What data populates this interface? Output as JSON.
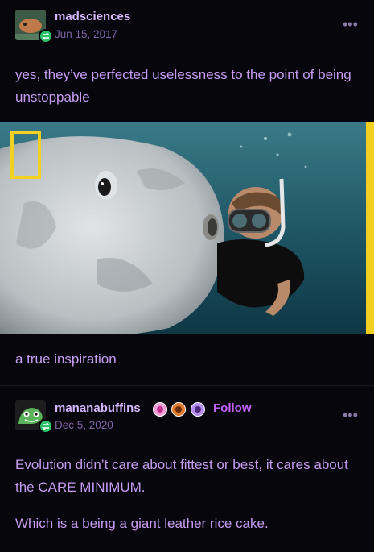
{
  "post1": {
    "username": "madsciences",
    "date": "Jun 15, 2017",
    "more": "•••",
    "caption": "yes, they’ve perfected uselessness to the point of being unstoppable",
    "image_caption": "a true inspiration"
  },
  "post2": {
    "username": "mananabuffins",
    "follow_label": "Follow",
    "date": "Dec 5, 2020",
    "more": "•••",
    "paragraph1": "Evolution didn’t care about fittest or best, it cares about the CARE MINIMUM.",
    "paragraph2": "Which is a being a giant leather rice cake."
  },
  "colors": {
    "background": "#07060d",
    "text": "#c59cf0",
    "follow": "#c060ff",
    "reblog_badge": "#2ec26a",
    "natgeo_yellow": "#f2d022"
  }
}
